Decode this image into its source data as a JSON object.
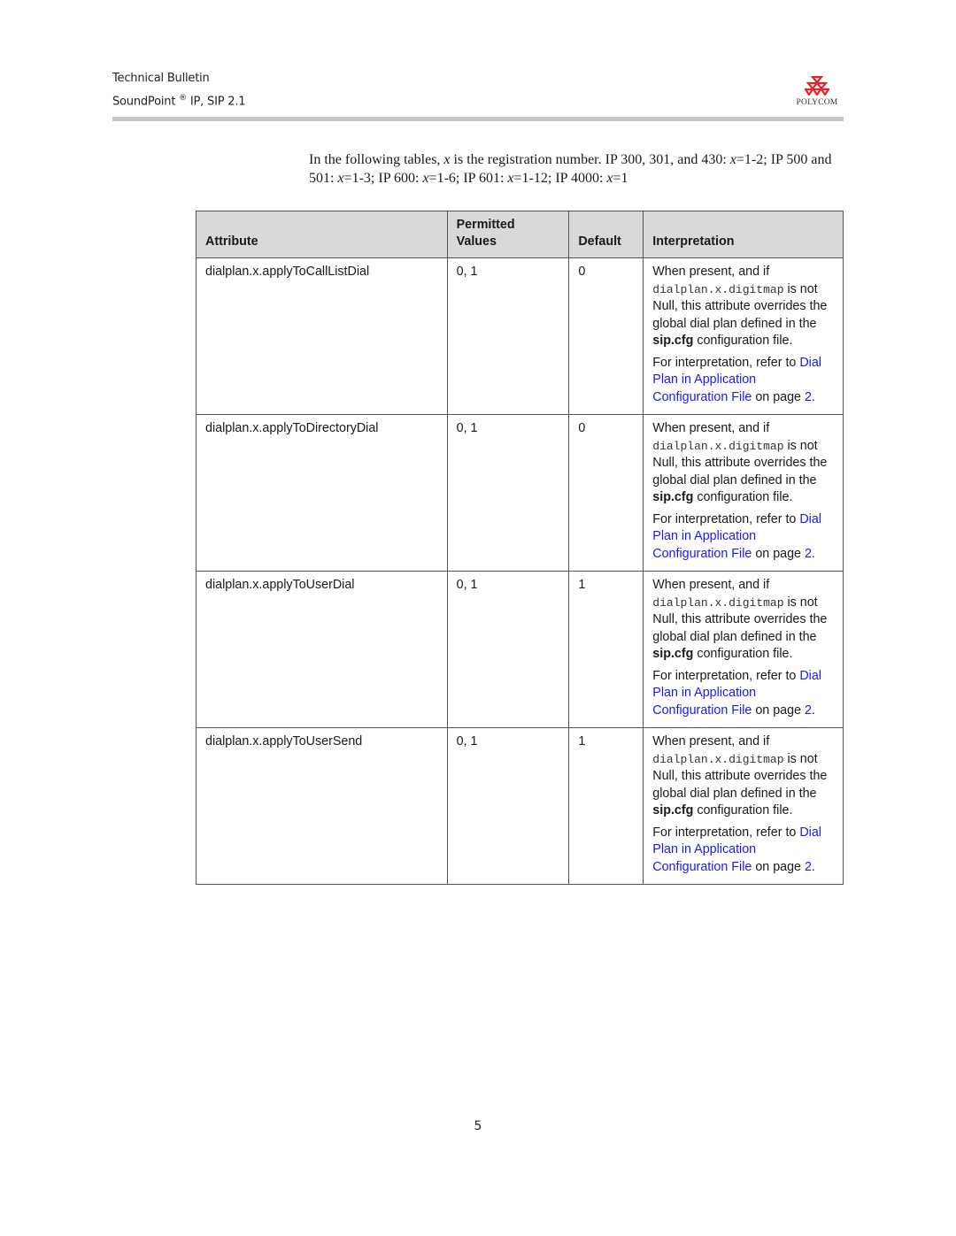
{
  "header": {
    "line1": "Technical Bulletin",
    "line2_prefix": "SoundPoint",
    "line2_reg": "®",
    "line2_suffix": " IP, SIP 2.1",
    "logo_icon": "polycom-triangles-icon",
    "logo_text": "POLYCOM",
    "brand_color": "#e0242c"
  },
  "intro": {
    "p1": "In the following tables, ",
    "var": "x",
    "p2": " is the registration number. IP 300, 301, and 430: ",
    "p3": "=1-2; IP 500 and 501: ",
    "p4": "=1-3; IP 600: ",
    "p5": "=1-6; IP 601: ",
    "p6": "=1-12; IP 4000: ",
    "p7": "=1"
  },
  "table": {
    "headers": {
      "attribute": "Attribute",
      "permitted_line1": "Permitted",
      "permitted_line2": "Values",
      "default": "Default",
      "interpretation": "Interpretation"
    },
    "rows": [
      {
        "attribute": "dialplan.x.applyToCallListDial",
        "values": "0, 1",
        "default": "0",
        "interp_line1": "When present, and if ",
        "interp_code": "dialplan.x.digitmap",
        "interp_line2": " is not Null, this attribute overrides the global dial plan defined in the ",
        "interp_bold": "sip.cfg",
        "interp_line3": " configuration file.",
        "refer_text": "For interpretation, refer to ",
        "link_text": "Dial Plan in Application Configuration File",
        "on_page": " on page ",
        "page_link": "2",
        "period": "."
      },
      {
        "attribute": "dialplan.x.applyToDirectoryDial",
        "values": "0, 1",
        "default": "0",
        "interp_line1": "When present, and if ",
        "interp_code": "dialplan.x.digitmap",
        "interp_line2": " is not Null, this attribute overrides the global dial plan defined in the ",
        "interp_bold": "sip.cfg",
        "interp_line3": " configuration file.",
        "refer_text": "For interpretation, refer to ",
        "link_text": "Dial Plan in Application Configuration File",
        "on_page": " on page ",
        "page_link": "2",
        "period": "."
      },
      {
        "attribute": "dialplan.x.applyToUserDial",
        "values": "0, 1",
        "default": "1",
        "interp_line1": "When present, and if ",
        "interp_code": "dialplan.x.digitmap",
        "interp_line2": " is not Null, this attribute overrides the global dial plan defined in the ",
        "interp_bold": "sip.cfg",
        "interp_line3": " configuration file.",
        "refer_text": "For interpretation, refer to ",
        "link_text": "Dial Plan in Application Configuration File",
        "on_page": " on page ",
        "page_link": "2",
        "period": "."
      },
      {
        "attribute": "dialplan.x.applyToUserSend",
        "values": "0, 1",
        "default": "1",
        "interp_line1": "When present, and if ",
        "interp_code": "dialplan.x.digitmap",
        "interp_line2": " is not Null, this attribute overrides the global dial plan defined in the ",
        "interp_bold": "sip.cfg",
        "interp_line3": " configuration file.",
        "refer_text": "For interpretation, refer to ",
        "link_text": "Dial Plan in Application Configuration File",
        "on_page": " on page ",
        "page_link": "2",
        "period": "."
      }
    ]
  },
  "footer": {
    "page_number": "5"
  }
}
